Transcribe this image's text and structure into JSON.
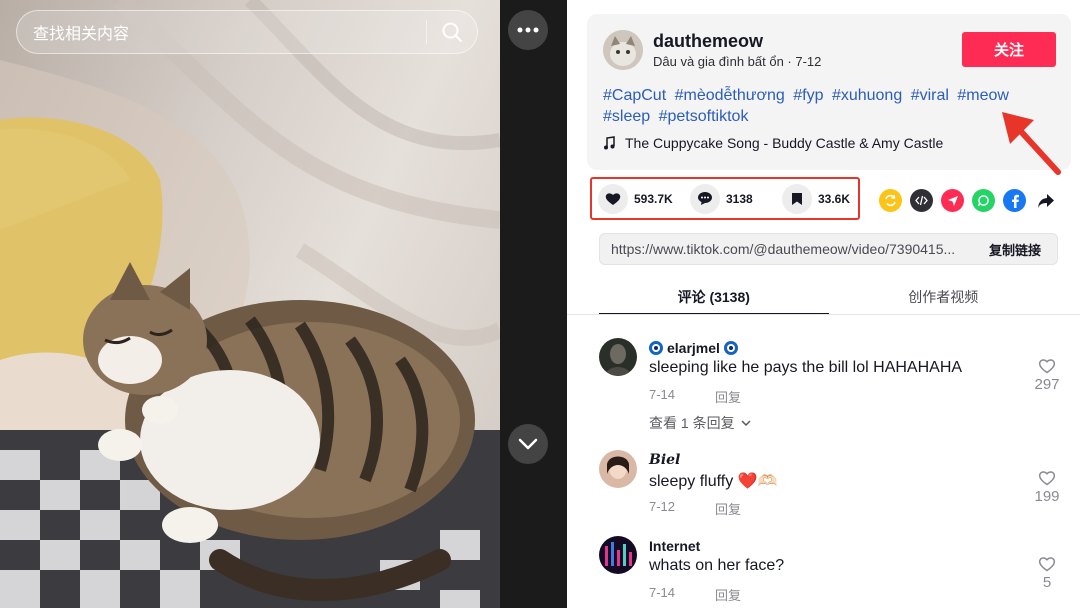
{
  "search": {
    "placeholder": "查找相关内容"
  },
  "author": {
    "name": "dauthemeow",
    "subtitle": "Dâu và gia đình bất ổn · 7-12",
    "follow_label": "关注"
  },
  "hashtags": [
    "#CapCut",
    "#mèodễthương",
    "#fyp",
    "#xuhuong",
    "#viral",
    "#meow",
    "#sleep",
    "#petsoftiktok"
  ],
  "music": "The Cuppycake Song - Buddy Castle & Amy Castle",
  "stats": {
    "likes": "593.7K",
    "comments": "3138",
    "favorites": "33.6K"
  },
  "share_icons": [
    "repost-icon",
    "embed-icon",
    "send-icon",
    "whatsapp-icon",
    "facebook-icon",
    "share-arrow-icon"
  ],
  "link": {
    "url": "https://www.tiktok.com/@dauthemeow/video/7390415...",
    "copy_label": "复制链接"
  },
  "tabs": [
    {
      "label": "评论 (3138)"
    },
    {
      "label": "创作者视频"
    }
  ],
  "comments": [
    {
      "user": "elarjmel",
      "text": "sleeping like he pays the bill lol HAHAHAHA",
      "date": "7-14",
      "reply_label": "回复",
      "likes": "297",
      "view_replies": "查看 1 条回复"
    },
    {
      "user": "𝑩𝒊𝒆𝒍",
      "text": "sleepy fluffy ❤️🫶🏻",
      "date": "7-12",
      "reply_label": "回复",
      "likes": "199"
    },
    {
      "user": "Internet",
      "text": "whats on her face?",
      "date": "7-14",
      "reply_label": "回复",
      "likes": "5"
    }
  ],
  "colors": {
    "accent": "#fe2c55",
    "hashtag": "#2b5db9",
    "highlight": "#e8352a"
  }
}
